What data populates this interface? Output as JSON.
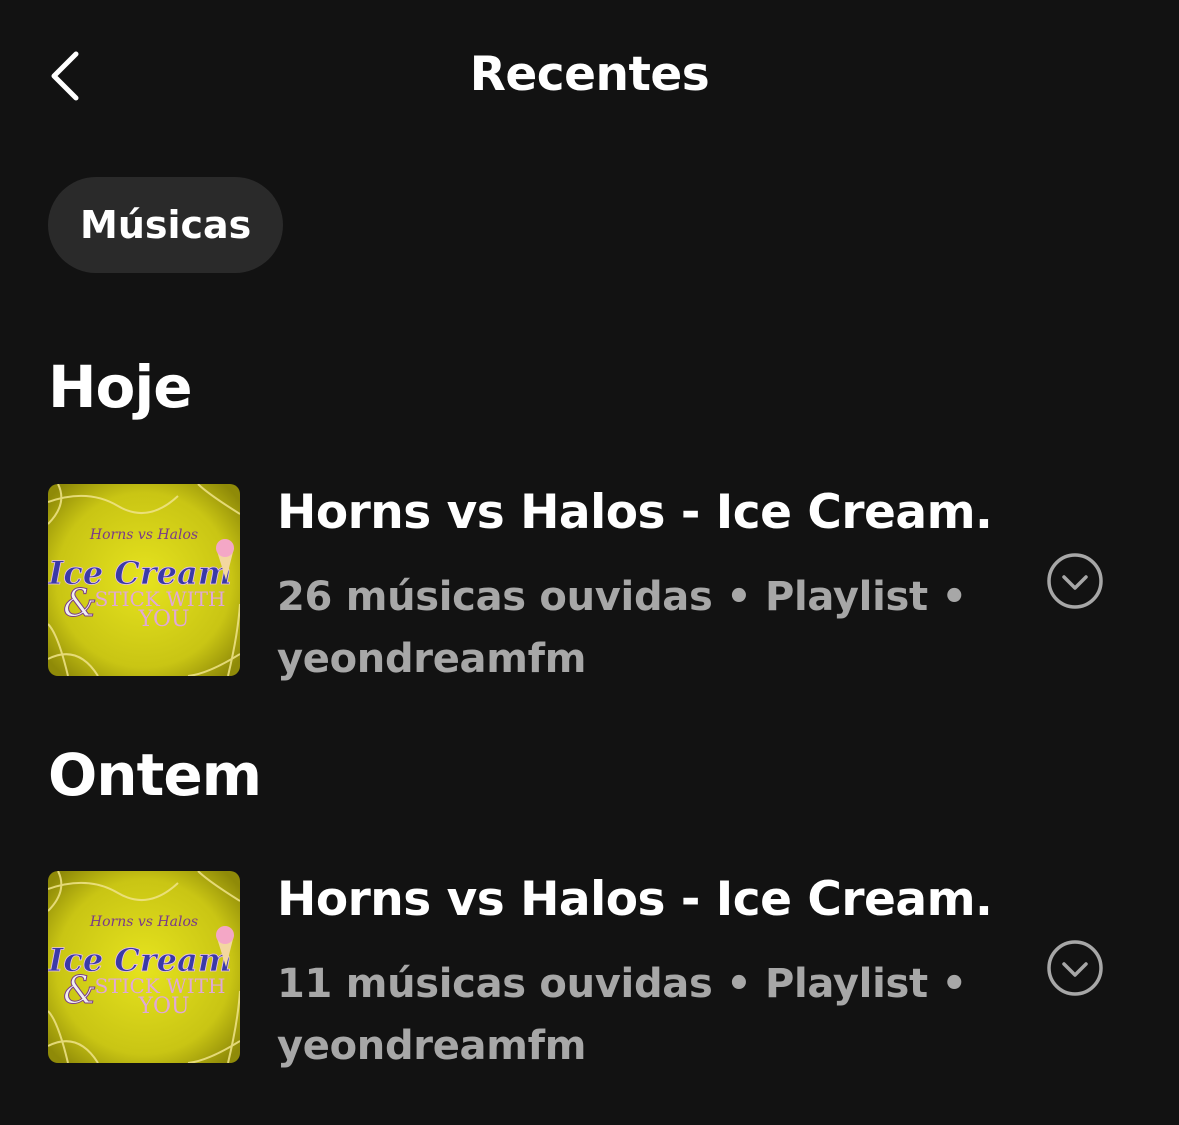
{
  "header": {
    "title": "Recentes",
    "back_icon": "chevron-left-icon"
  },
  "filters": {
    "active_chip": "Músicas"
  },
  "sections": [
    {
      "heading": "Hoje",
      "items": [
        {
          "title": "Horns vs Halos -  Ice Cream...",
          "subtitle_line1": "26 músicas ouvidas • Playlist •",
          "subtitle_line2": "yeondreamfm",
          "cover": {
            "top_text": "Horns vs Halos",
            "main_text": "Ice Cream",
            "amp": "&",
            "sub_text": "STICK WITH",
            "sub_text2": "YOU"
          },
          "action_icon": "chevron-down-circle-icon"
        }
      ]
    },
    {
      "heading": "Ontem",
      "items": [
        {
          "title": "Horns vs Halos -  Ice Cream...",
          "subtitle_line1": "11 músicas ouvidas • Playlist •",
          "subtitle_line2": "yeondreamfm",
          "cover": {
            "top_text": "Horns vs Halos",
            "main_text": "Ice Cream",
            "amp": "&",
            "sub_text": "STICK WITH",
            "sub_text2": "YOU"
          },
          "action_icon": "chevron-down-circle-icon"
        }
      ]
    }
  ],
  "colors": {
    "background": "#121212",
    "chip_background": "#2a2a2a",
    "secondary_text": "#a7a7a7",
    "cover_yellow": "#d8d41a"
  }
}
